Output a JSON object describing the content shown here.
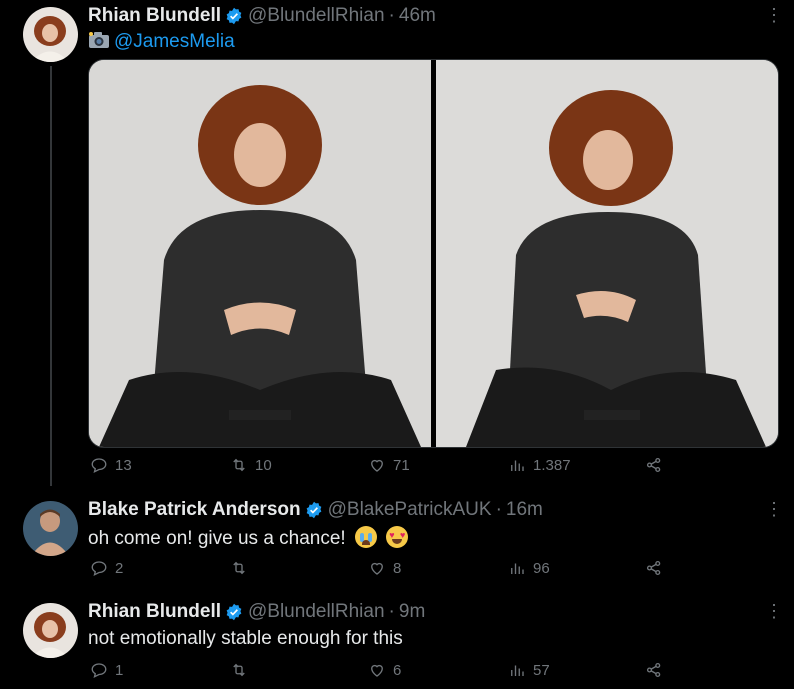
{
  "tweets": [
    {
      "name": "Rhian Blundell",
      "handle": "@BlundellRhian",
      "separator": "·",
      "time": "46m",
      "camera_icon": "camera-icon",
      "mention": "@JamesMelia",
      "media_count": 2,
      "replies": "13",
      "retweets": "10",
      "likes": "71",
      "views": "1.387"
    },
    {
      "name": "Blake Patrick Anderson",
      "handle": "@BlakePatrickAUK",
      "separator": "·",
      "time": "16m",
      "text": "oh come on! give us a chance!",
      "emojis": [
        "crying-face-icon",
        "heart-eyes-icon"
      ],
      "replies": "2",
      "retweets": "",
      "likes": "8",
      "views": "96"
    },
    {
      "name": "Rhian Blundell",
      "handle": "@BlundellRhian",
      "separator": "·",
      "time": "9m",
      "text": "not emotionally stable enough for this",
      "replies": "1",
      "retweets": "",
      "likes": "6",
      "views": "57"
    }
  ],
  "colors": {
    "background": "#000000",
    "text": "#e7e9ea",
    "muted": "#71767b",
    "accent": "#1d9bf0",
    "divider": "#333639"
  }
}
